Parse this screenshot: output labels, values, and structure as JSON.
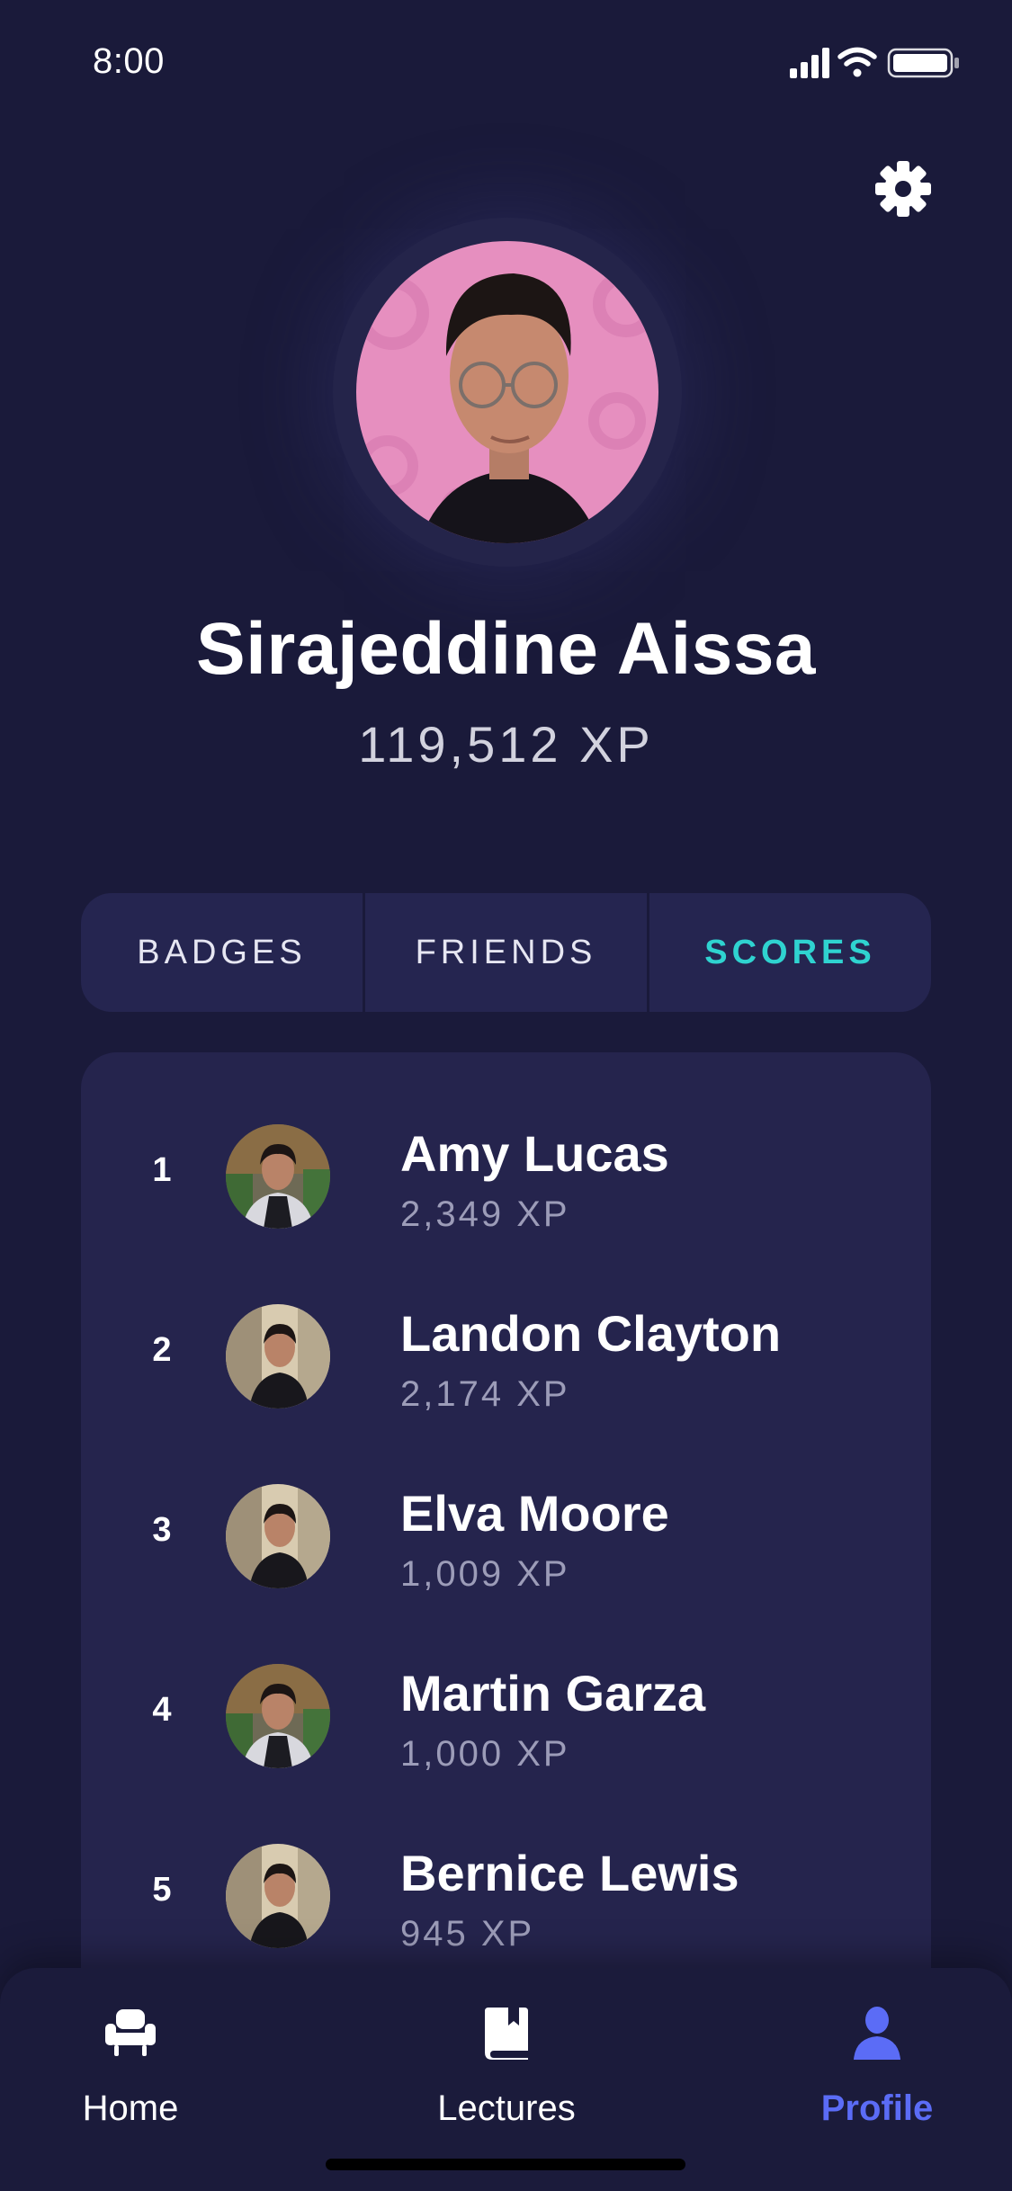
{
  "status_bar": {
    "time": "8:00",
    "icons": [
      "cellular-signal-icon",
      "wifi-icon",
      "battery-icon"
    ]
  },
  "header": {
    "settings_icon": "gear-icon"
  },
  "profile": {
    "name": "Sirajeddine Aissa",
    "xp": "119,512 XP"
  },
  "tabs": [
    {
      "label": "BADGES",
      "active": false
    },
    {
      "label": "FRIENDS",
      "active": false
    },
    {
      "label": "SCORES",
      "active": true
    }
  ],
  "scores": [
    {
      "rank": "1",
      "name": "Amy Lucas",
      "xp": "2,349 XP"
    },
    {
      "rank": "2",
      "name": "Landon Clayton",
      "xp": "2,174 XP"
    },
    {
      "rank": "3",
      "name": "Elva Moore",
      "xp": "1,009 XP"
    },
    {
      "rank": "4",
      "name": "Martin Garza",
      "xp": "1,000 XP"
    },
    {
      "rank": "5",
      "name": "Bernice Lewis",
      "xp": "945 XP"
    }
  ],
  "bottom_nav": [
    {
      "label": "Home",
      "icon": "armchair-icon",
      "active": false
    },
    {
      "label": "Lectures",
      "icon": "book-icon",
      "active": false
    },
    {
      "label": "Profile",
      "icon": "user-icon",
      "active": true
    }
  ],
  "colors": {
    "background": "#1a1a3a",
    "card": "#25244d",
    "accent_tab": "#2fd3d0",
    "accent_nav": "#5b6cf6"
  }
}
